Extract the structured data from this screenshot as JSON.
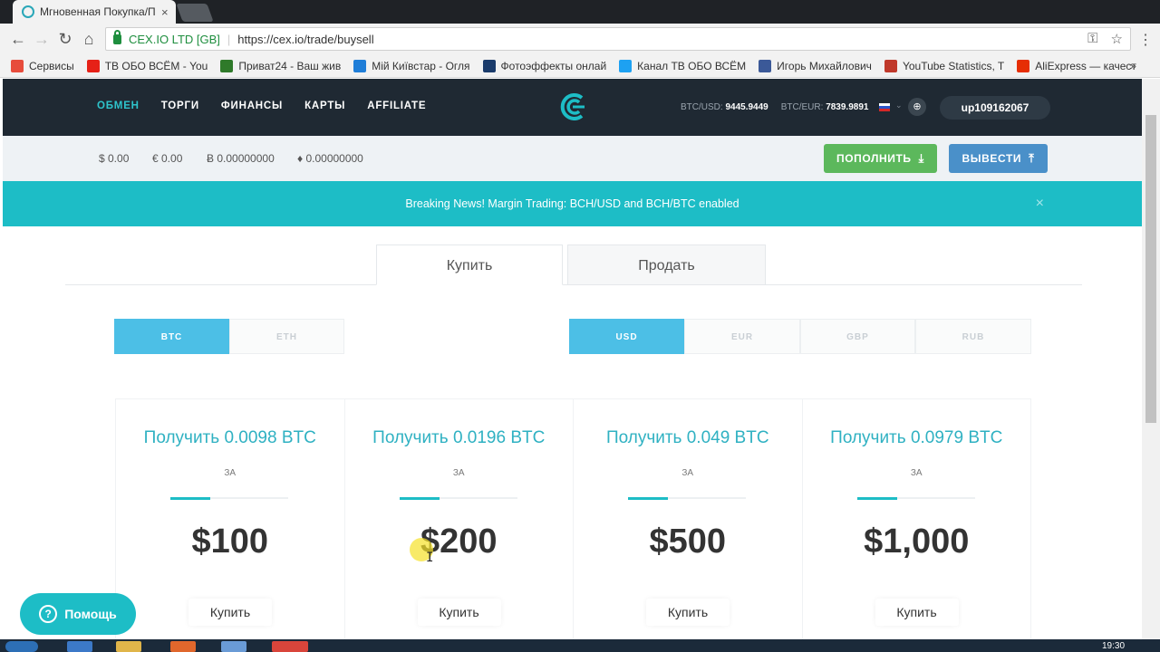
{
  "browser": {
    "tab_title": "Мгновенная Покупка/П",
    "tab_close": "×",
    "cert_label": "CEX.IO LTD [GB]",
    "url": "https://cex.io/trade/buysell"
  },
  "bookmarks": [
    {
      "label": "Сервисы",
      "color": "#e74c3c"
    },
    {
      "label": "ТВ ОБО ВСЁМ - You",
      "color": "#e62117"
    },
    {
      "label": "Приват24 - Ваш жив",
      "color": "#2f7a2a"
    },
    {
      "label": "Мій Київстар - Огля",
      "color": "#1f7ed8"
    },
    {
      "label": "Фотоэффекты онлай",
      "color": "#1a3b6b"
    },
    {
      "label": "Канал ТВ ОБО ВСЁМ",
      "color": "#1da1f2"
    },
    {
      "label": "Игорь Михайлович",
      "color": "#3b5998"
    },
    {
      "label": "YouTube Statistics, T",
      "color": "#c0392b"
    },
    {
      "label": "AliExpress — качест",
      "color": "#e62e04"
    }
  ],
  "header": {
    "nav": [
      "ОБМЕН",
      "ТОРГИ",
      "ФИНАНСЫ",
      "КАРТЫ",
      "AFFILIATE"
    ],
    "rates": {
      "btc_usd_label": "BTC/USD:",
      "btc_usd_value": "9445.9449",
      "btc_eur_label": "BTC/EUR:",
      "btc_eur_value": "7839.9891"
    },
    "username": "up109162067"
  },
  "balances": {
    "usd": "$ 0.00",
    "eur": "€ 0.00",
    "btc": "Ƀ 0.00000000",
    "eth": "♦ 0.00000000"
  },
  "actions": {
    "deposit": "ПОПОЛНИТЬ",
    "withdraw": "ВЫВЕСТИ"
  },
  "news": {
    "text": "Breaking News! Margin Trading: BCH/USD and BCH/BTC enabled",
    "close": "×"
  },
  "trade_tabs": {
    "buy": "Купить",
    "sell": "Продать"
  },
  "crypto_options": [
    "BTC",
    "ETH"
  ],
  "crypto_selected": "BTC",
  "fiat_options": [
    "USD",
    "EUR",
    "GBP",
    "RUB"
  ],
  "fiat_selected": "USD",
  "cards": [
    {
      "get": "Получить 0.0098 BTC",
      "za": "ЗА",
      "price": "$100",
      "buy": "Купить"
    },
    {
      "get": "Получить 0.0196 BTC",
      "za": "ЗА",
      "price": "$200",
      "buy": "Купить"
    },
    {
      "get": "Получить 0.049 BTC",
      "za": "ЗА",
      "price": "$500",
      "buy": "Купить"
    },
    {
      "get": "Получить 0.0979 BTC",
      "za": "ЗА",
      "price": "$1,000",
      "buy": "Купить"
    }
  ],
  "help": "Помощь",
  "clock": "19:30",
  "colors": {
    "accent": "#1dbdc6",
    "header_bg": "#1f2933",
    "deposit": "#5cb85c",
    "withdraw": "#4a90c9",
    "segment_on": "#4cbfe6"
  }
}
